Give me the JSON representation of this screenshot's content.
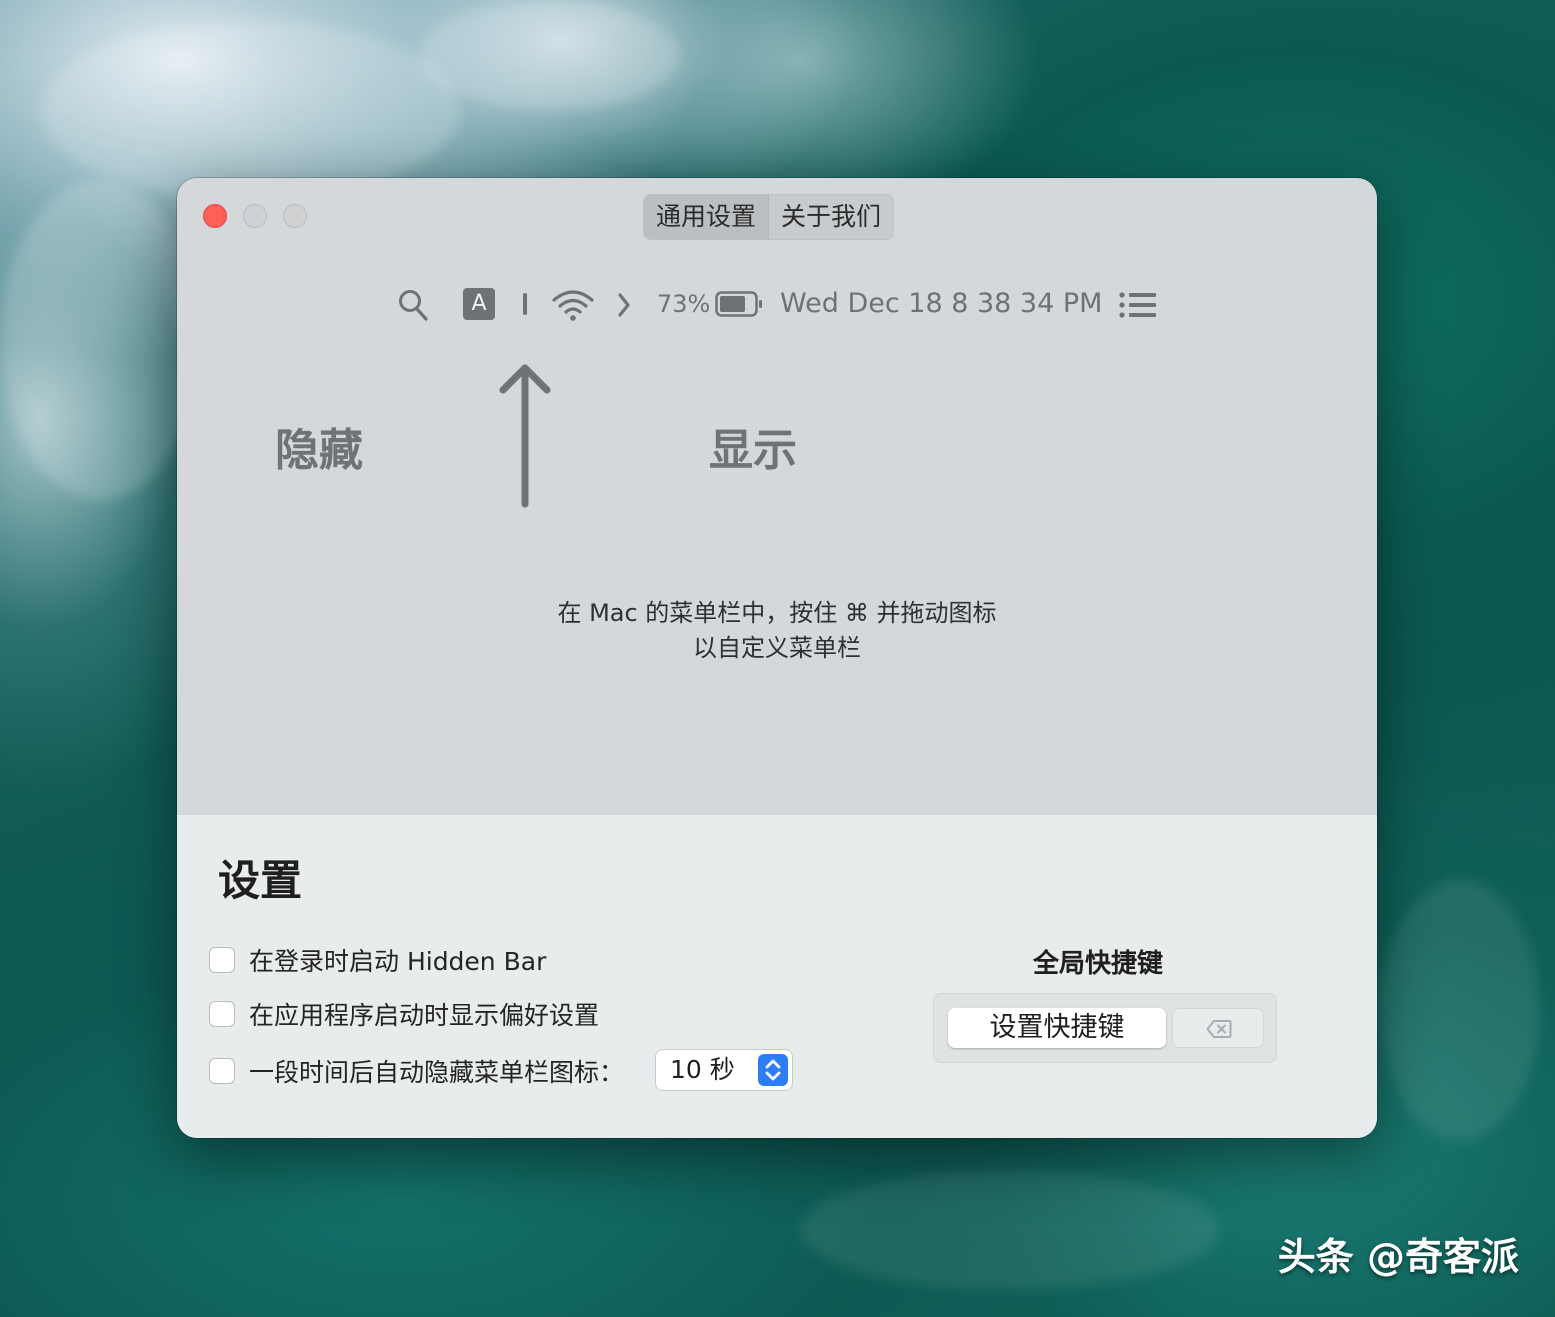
{
  "window": {
    "tabs": [
      {
        "label": "通用设置",
        "selected": true
      },
      {
        "label": "关于我们",
        "selected": false
      }
    ]
  },
  "menubar_preview": {
    "input_indicator": "A",
    "battery_percent": "73%",
    "datetime": "Wed Dec 18  8 38 34 PM",
    "icons": [
      "search-icon",
      "input-source-icon",
      "separator-icon",
      "wifi-icon",
      "chevron-right-icon",
      "battery-icon",
      "menu-list-icon"
    ]
  },
  "labels": {
    "hide": "隐藏",
    "show": "显示"
  },
  "hint": {
    "line1": "在 Mac 的菜单栏中，按住 ⌘ 并拖动图标",
    "line2": "以自定义菜单栏"
  },
  "settings": {
    "title": "设置",
    "options": [
      {
        "label": "在登录时启动 Hidden Bar",
        "checked": false
      },
      {
        "label": "在应用程序启动时显示偏好设置",
        "checked": false
      },
      {
        "label": "一段时间后自动隐藏菜单栏图标：",
        "checked": false
      }
    ],
    "delay": "10 秒",
    "shortcut": {
      "title": "全局快捷键",
      "button_label": "设置快捷键"
    }
  },
  "watermark": "头条 @奇客派",
  "colors": {
    "close": "#fe5f57",
    "accent": "#2e7cf6"
  }
}
